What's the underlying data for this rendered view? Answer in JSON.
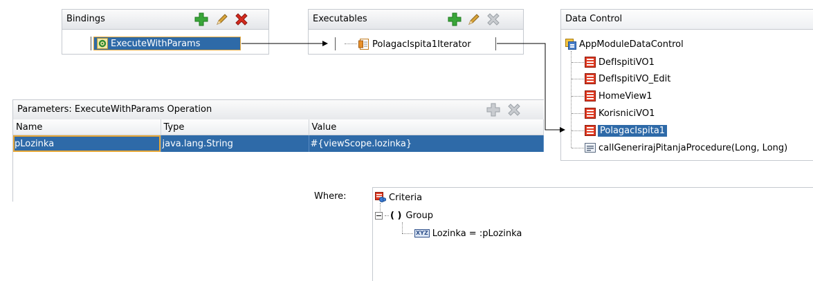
{
  "bindings": {
    "title": "Bindings",
    "item": "ExecuteWithParams"
  },
  "executables": {
    "title": "Executables",
    "item": "PolagacIspita1Iterator"
  },
  "data_control": {
    "title": "Data Control",
    "root": "AppModuleDataControl",
    "children": [
      "DefIspitiVO1",
      "DefIspitiVO_Edit",
      "HomeView1",
      "KorisniciVO1",
      "PolagacIspita1",
      "callGenerirajPitanjaProcedure(Long, Long)"
    ],
    "selected_index": 4
  },
  "parameters": {
    "title": "Parameters:  ExecuteWithParams Operation",
    "columns": [
      "Name",
      "Type",
      "Value"
    ],
    "rows": [
      {
        "name": "pLozinka",
        "type": "java.lang.String",
        "value": "#{viewScope.lozinka}"
      }
    ]
  },
  "where": {
    "label": "Where:",
    "criteria": "Criteria",
    "group_paren": "( )",
    "group": "Group",
    "condition_badge": "XYZ",
    "condition": "Lozinka = :pLozinka"
  },
  "colors": {
    "selection": "#2e6aa8",
    "add": "#3aa63a",
    "delete": "#d42a1e",
    "edit": "#d8a43a",
    "disabled": "#9aa0a6",
    "focus": "#e7a736"
  }
}
